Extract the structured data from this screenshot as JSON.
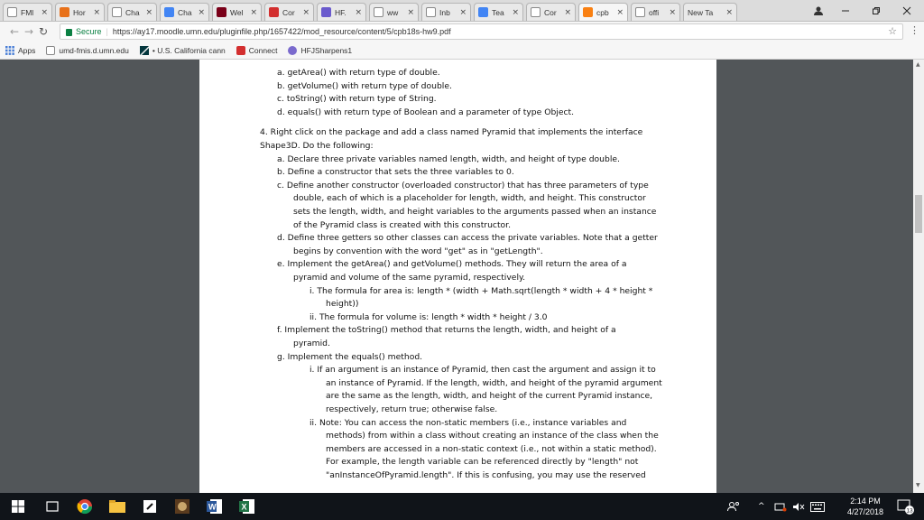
{
  "tabs": [
    {
      "label": "FMl",
      "fav": "doc-icon",
      "color": "#ffffff"
    },
    {
      "label": "Hor",
      "fav": "c-icon",
      "color": "#e8711a"
    },
    {
      "label": "Cha",
      "fav": "gmail-icon",
      "color": "#ffffff"
    },
    {
      "label": "Cha",
      "fav": "docs-icon",
      "color": "#4285f4"
    },
    {
      "label": "Wel",
      "fav": "umn-icon",
      "color": "#7a0019"
    },
    {
      "label": "Cor",
      "fav": "connect-icon",
      "color": "#d32f2f"
    },
    {
      "label": "HF.",
      "fav": "globe-icon",
      "color": "#6a5acd"
    },
    {
      "label": "ww",
      "fav": "doc-icon",
      "color": "#ffffff"
    },
    {
      "label": "Inb",
      "fav": "gmail-icon",
      "color": "#ffffff"
    },
    {
      "label": "Tea",
      "fav": "docs-icon",
      "color": "#4285f4"
    },
    {
      "label": "Cor",
      "fav": "doc-icon",
      "color": "#ffffff"
    },
    {
      "label": "cpb",
      "fav": "moodle-icon",
      "color": "#f98012"
    },
    {
      "label": "offi",
      "fav": "google-icon",
      "color": "#ffffff"
    },
    {
      "label": "New Ta",
      "fav": "",
      "color": ""
    }
  ],
  "omnibox": {
    "secure_label": "Secure",
    "url": "https://ay17.moodle.umn.edu/pluginfile.php/1657422/mod_resource/content/5/cpb18s-hw9.pdf"
  },
  "bookmarks": [
    {
      "label": "Apps",
      "icon": "apps-icon"
    },
    {
      "label": "umd-fmis.d.umn.edu",
      "icon": "page-icon"
    },
    {
      "label": "• U.S. California cann",
      "icon": "zendesk-icon"
    },
    {
      "label": "Connect",
      "icon": "connect-icon"
    },
    {
      "label": "HFJSharpens1",
      "icon": "globe-icon"
    }
  ],
  "document_lines": [
    {
      "text": "a.  getArea() with return type of double.",
      "indent": "l1"
    },
    {
      "text": "b.  getVolume() with return type of double.",
      "indent": "l1"
    },
    {
      "text": "c.  toString() with return type of String.",
      "indent": "l1"
    },
    {
      "text": "d.  equals() with return type of Boolean and a parameter of type Object.",
      "indent": "l1"
    },
    {
      "text": "",
      "indent": "gap"
    },
    {
      "text": "4.  Right click on the package and add a class named Pyramid that implements the interface",
      "indent": "l0"
    },
    {
      "text": "Shape3D. Do the following:",
      "indent": "l0c"
    },
    {
      "text": "a.  Declare three private variables named length, width, and height of type double.",
      "indent": "l1"
    },
    {
      "text": "b.  Define a constructor that sets the three variables to 0.",
      "indent": "l1"
    },
    {
      "text": "c.  Define another constructor (overloaded constructor) that has three parameters of type",
      "indent": "l1"
    },
    {
      "text": "double, each of which is a placeholder for length, width, and height. This constructor",
      "indent": "l1c"
    },
    {
      "text": "sets the length, width, and height variables to the arguments passed when an instance",
      "indent": "l1c"
    },
    {
      "text": "of the Pyramid class is created with this constructor.",
      "indent": "l1c"
    },
    {
      "text": "d.  Define three getters so other classes can access the private variables. Note that a getter",
      "indent": "l1"
    },
    {
      "text": "begins by convention with the word \"get\" as in \"getLength\".",
      "indent": "l1c"
    },
    {
      "text": "e.  Implement the getArea() and getVolume() methods. They will return the area of a",
      "indent": "l1"
    },
    {
      "text": "pyramid and volume of the same pyramid, respectively.",
      "indent": "l1c"
    },
    {
      "text": "i.   The formula for area is: length * (width + Math.sqrt(length * width + 4 * height *",
      "indent": "l2"
    },
    {
      "text": "height))",
      "indent": "l2c"
    },
    {
      "text": "ii.  The formula for volume is: length * width * height / 3.0",
      "indent": "l2"
    },
    {
      "text": "f.  Implement the toString() method that returns the length, width, and height of a",
      "indent": "l1"
    },
    {
      "text": "pyramid.",
      "indent": "l1c"
    },
    {
      "text": "g.  Implement the equals() method.",
      "indent": "l1"
    },
    {
      "text": "i.   If an argument is an instance of Pyramid, then cast the argument and assign it to",
      "indent": "l2"
    },
    {
      "text": "an instance of Pyramid. If the length, width, and height of the pyramid argument",
      "indent": "l2c"
    },
    {
      "text": "are the same as the length, width, and height of the current Pyramid instance,",
      "indent": "l2c"
    },
    {
      "text": "respectively, return true; otherwise false.",
      "indent": "l2c"
    },
    {
      "text": "ii.  Note: You can access the non-static members (i.e., instance variables and",
      "indent": "l2"
    },
    {
      "text": "methods) from within a class without creating an instance of the class when the",
      "indent": "l2c"
    },
    {
      "text": "members are accessed in a non-static context (i.e., not within a static method).",
      "indent": "l2c"
    },
    {
      "text": "For example, the length variable can be referenced directly by \"length\" not",
      "indent": "l2c"
    },
    {
      "text": "\"anInstanceOfPyramid.length\". If this is confusing, you may use the reserved",
      "indent": "l2c"
    }
  ],
  "taskbar": {
    "time": "2:14 PM",
    "date": "4/27/2018",
    "notification_count": "13"
  }
}
